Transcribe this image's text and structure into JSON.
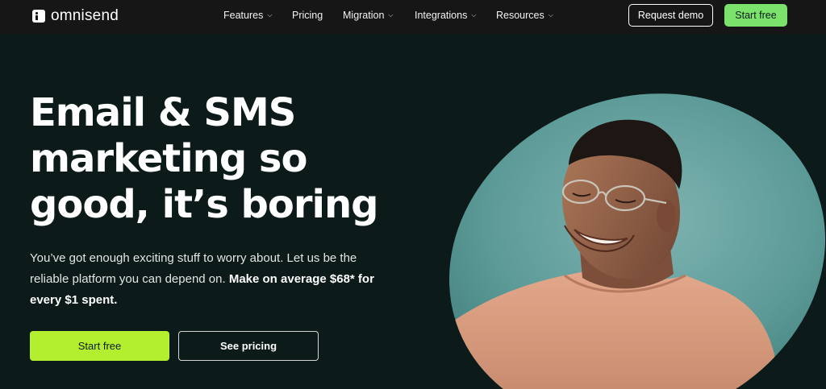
{
  "nav": {
    "logo_text": "omnisend",
    "menu": [
      {
        "label": "Features",
        "has_dropdown": true
      },
      {
        "label": "Pricing",
        "has_dropdown": false
      },
      {
        "label": "Migration",
        "has_dropdown": true
      },
      {
        "label": "Integrations",
        "has_dropdown": true
      },
      {
        "label": "Resources",
        "has_dropdown": true
      }
    ],
    "request_demo_label": "Request demo",
    "start_free_label": "Start free"
  },
  "hero": {
    "headline_lines": [
      "Email & SMS",
      "marketing so",
      "good, it’s boring"
    ],
    "subtext_lead": "You’ve got enough exciting stuff to worry about. Let us be the reliable platform you can depend on. ",
    "subtext_strong": "Make on average $68* for every $1 spent.",
    "primary_cta": "Start free",
    "secondary_cta": "See pricing",
    "image_alt": "smiling man in glasses"
  },
  "colors": {
    "background": "#0c1a19",
    "nav_background": "#171616",
    "nav_cta": "#7be36c",
    "hero_cta": "#b4ef2f",
    "image_backdrop": "#5c9a98"
  }
}
